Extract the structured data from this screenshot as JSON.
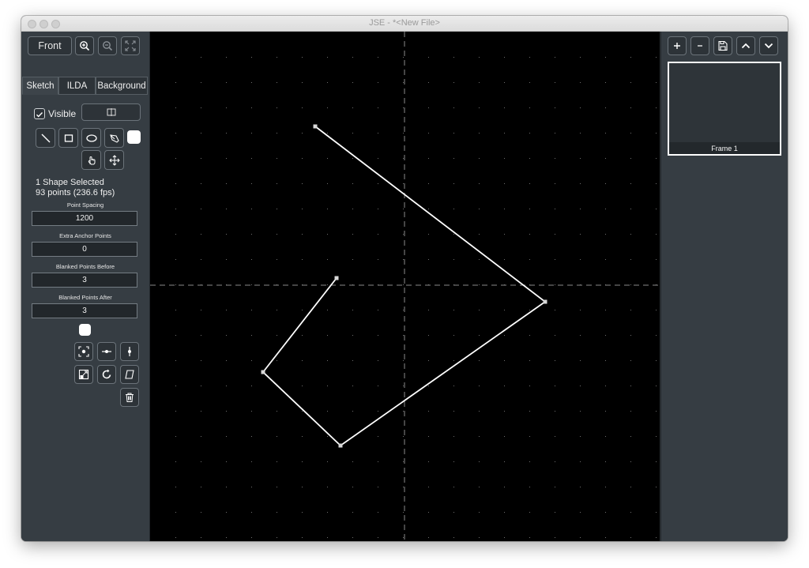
{
  "window": {
    "title": "JSE - *<New File>"
  },
  "toolbar": {
    "view_label": "Front"
  },
  "tabs": [
    {
      "label": "Sketch"
    },
    {
      "label": "ILDA"
    },
    {
      "label": "Background"
    }
  ],
  "sketch": {
    "visible_label": "Visible",
    "visible_checked": true,
    "selection_summary": "1 Shape Selected",
    "points_summary": "93 points (236.6 fps)",
    "fields": [
      {
        "label": "Point Spacing",
        "value": "1200"
      },
      {
        "label": "Extra Anchor Points",
        "value": "0"
      },
      {
        "label": "Blanked Points Before",
        "value": "3"
      },
      {
        "label": "Blanked Points After",
        "value": "3"
      }
    ],
    "shape_color": "#ffffff"
  },
  "frames": [
    {
      "label": "Frame 1"
    }
  ],
  "colors": {
    "panel": "#363d43",
    "canvas": "#000000",
    "accent": "#ffffff"
  }
}
